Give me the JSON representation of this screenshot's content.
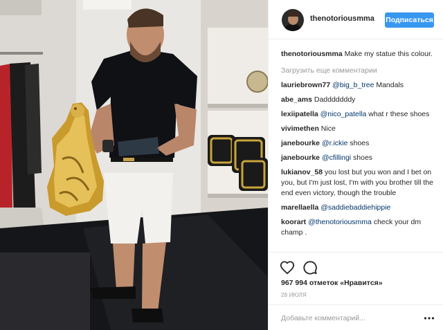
{
  "header": {
    "username": "thenotoriousmma",
    "follow_label": "Подписаться"
  },
  "caption": {
    "username": "thenotoriousmma",
    "text": " Make my statue this colour."
  },
  "load_more": "Загрузить еще комментарии",
  "comments": [
    {
      "user": "lauriebrown77",
      "mention": "@big_b_tree",
      "text": " Mandals"
    },
    {
      "user": "abe_ams",
      "mention": "",
      "text": " Dadddddddy"
    },
    {
      "user": "lexiipatella",
      "mention": "@nico_patella",
      "text": " what r these shoes"
    },
    {
      "user": "vivimethen",
      "mention": "",
      "text": " Nice"
    },
    {
      "user": "janebourke",
      "mention": "@r.ickie",
      "text": " shoes"
    },
    {
      "user": "janebourke",
      "mention": "@cfillingi",
      "text": " shoes"
    },
    {
      "user": "lukianov_58",
      "mention": "",
      "text": " you lost but you won and I bet on you, but I'm just lost, I'm with you brother till the end even victory, though the trouble"
    },
    {
      "user": "marellaella",
      "mention": "@saddiebaddiehippie",
      "text": ""
    },
    {
      "user": "koorart",
      "mention": "@thenotoriousmma",
      "text": " check your dm champ ."
    }
  ],
  "actions": {
    "like_icon": "heart-icon",
    "comment_icon": "comment-bubble-icon"
  },
  "likes_text": "967 994 отметок «Нравится»",
  "date_text": "28 ИЮЛЯ",
  "add_comment": {
    "placeholder": "Добавьте комментарий...",
    "more_icon": "more-options-icon"
  },
  "colors": {
    "accent": "#3897f0",
    "mention": "#003569",
    "muted": "#999999",
    "text": "#262626"
  }
}
